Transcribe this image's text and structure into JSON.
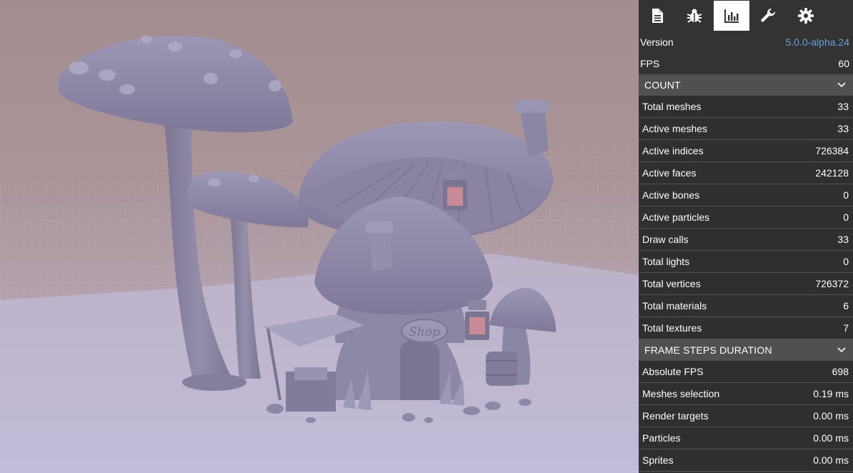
{
  "toolbar": {
    "tabs": [
      {
        "icon": "document-icon",
        "active": false
      },
      {
        "icon": "bug-icon",
        "active": false
      },
      {
        "icon": "statistics-icon",
        "active": true
      },
      {
        "icon": "wrench-icon",
        "active": false
      },
      {
        "icon": "gear-icon",
        "active": false
      }
    ]
  },
  "info": {
    "version_label": "Version",
    "version_value": "5.0.0-alpha.24",
    "fps_label": "FPS",
    "fps_value": "60"
  },
  "count": {
    "title": "COUNT",
    "rows": [
      {
        "label": "Total meshes",
        "value": "33"
      },
      {
        "label": "Active meshes",
        "value": "33"
      },
      {
        "label": "Active indices",
        "value": "726384"
      },
      {
        "label": "Active faces",
        "value": "242128"
      },
      {
        "label": "Active bones",
        "value": "0"
      },
      {
        "label": "Active particles",
        "value": "0"
      },
      {
        "label": "Draw calls",
        "value": "33"
      },
      {
        "label": "Total lights",
        "value": "0"
      },
      {
        "label": "Total vertices",
        "value": "726372"
      },
      {
        "label": "Total materials",
        "value": "6"
      },
      {
        "label": "Total textures",
        "value": "7"
      }
    ]
  },
  "frame_steps": {
    "title": "FRAME STEPS DURATION",
    "rows": [
      {
        "label": "Absolute FPS",
        "value": "698"
      },
      {
        "label": "Meshes selection",
        "value": "0.19 ms"
      },
      {
        "label": "Render targets",
        "value": "0.00 ms"
      },
      {
        "label": "Particles",
        "value": "0.00 ms"
      },
      {
        "label": "Sprites",
        "value": "0.00 ms"
      }
    ]
  },
  "scene": {
    "shop_sign": "Shop"
  },
  "colors": {
    "panel_bg": "#333333",
    "section_header_bg": "#505050",
    "link": "#6e9fd5",
    "model": "#8c86a5"
  }
}
